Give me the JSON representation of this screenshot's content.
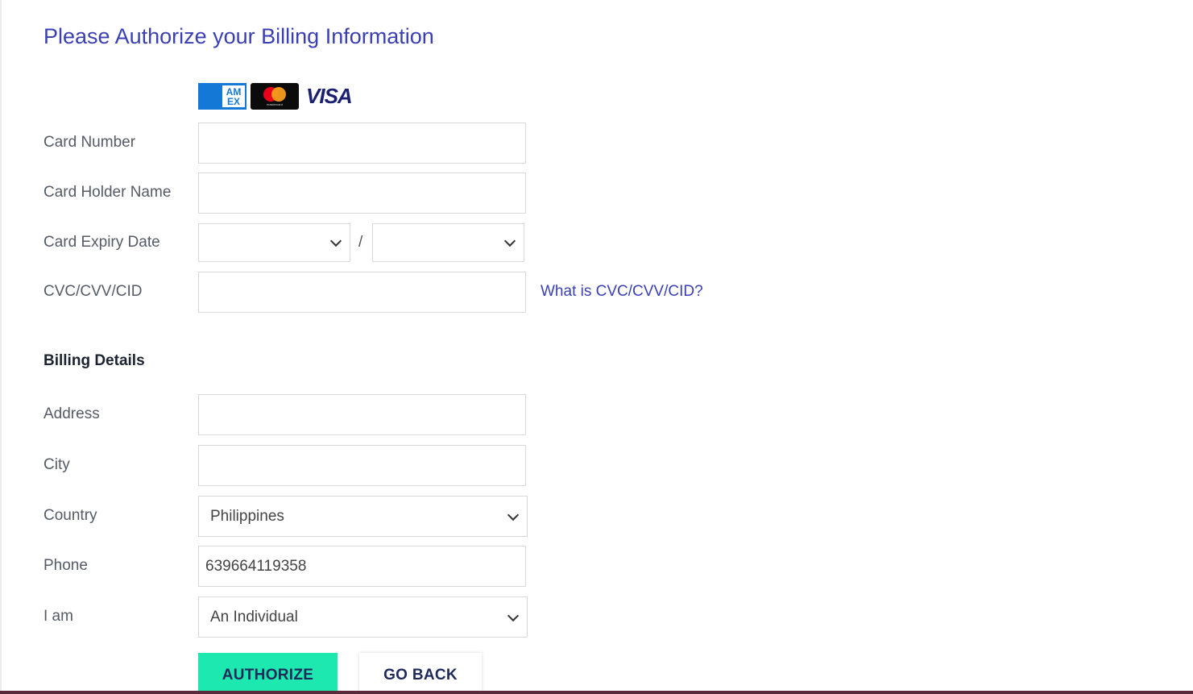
{
  "title": "Please Authorize your Billing Information",
  "card_logos": {
    "amex_text_line1": "AM",
    "amex_text_line2": "EX",
    "mastercard_text": "mastercard",
    "visa_text": "VISA",
    "colors": {
      "amex": "#1479d6",
      "mastercard_bg": "#0b0b0b",
      "visa": "#1a1f71"
    }
  },
  "card_form": {
    "card_number": {
      "label": "Card Number",
      "value": "",
      "placeholder": ""
    },
    "card_holder_name": {
      "label": "Card Holder Name",
      "value": "",
      "placeholder": ""
    },
    "card_expiry_date": {
      "label": "Card Expiry Date",
      "month_value": "",
      "separator": "/",
      "year_value": ""
    },
    "cvc": {
      "label": "CVC/CVV/CID",
      "value": "",
      "placeholder": "",
      "help_link": "What is CVC/CVV/CID?"
    }
  },
  "billing": {
    "heading": "Billing Details",
    "address": {
      "label": "Address",
      "value": ""
    },
    "city": {
      "label": "City",
      "value": ""
    },
    "country": {
      "label": "Country",
      "selected": "Philippines"
    },
    "phone": {
      "label": "Phone",
      "value": "639664119358"
    },
    "i_am": {
      "label": "I am",
      "selected": "An Individual"
    }
  },
  "buttons": {
    "authorize": "AUTHORIZE",
    "go_back": "GO BACK"
  },
  "colors": {
    "title": "#3a3fb3",
    "link": "#3a3fb3",
    "authorize_bg": "#1de8b0",
    "button_text": "#1f2a5a"
  }
}
